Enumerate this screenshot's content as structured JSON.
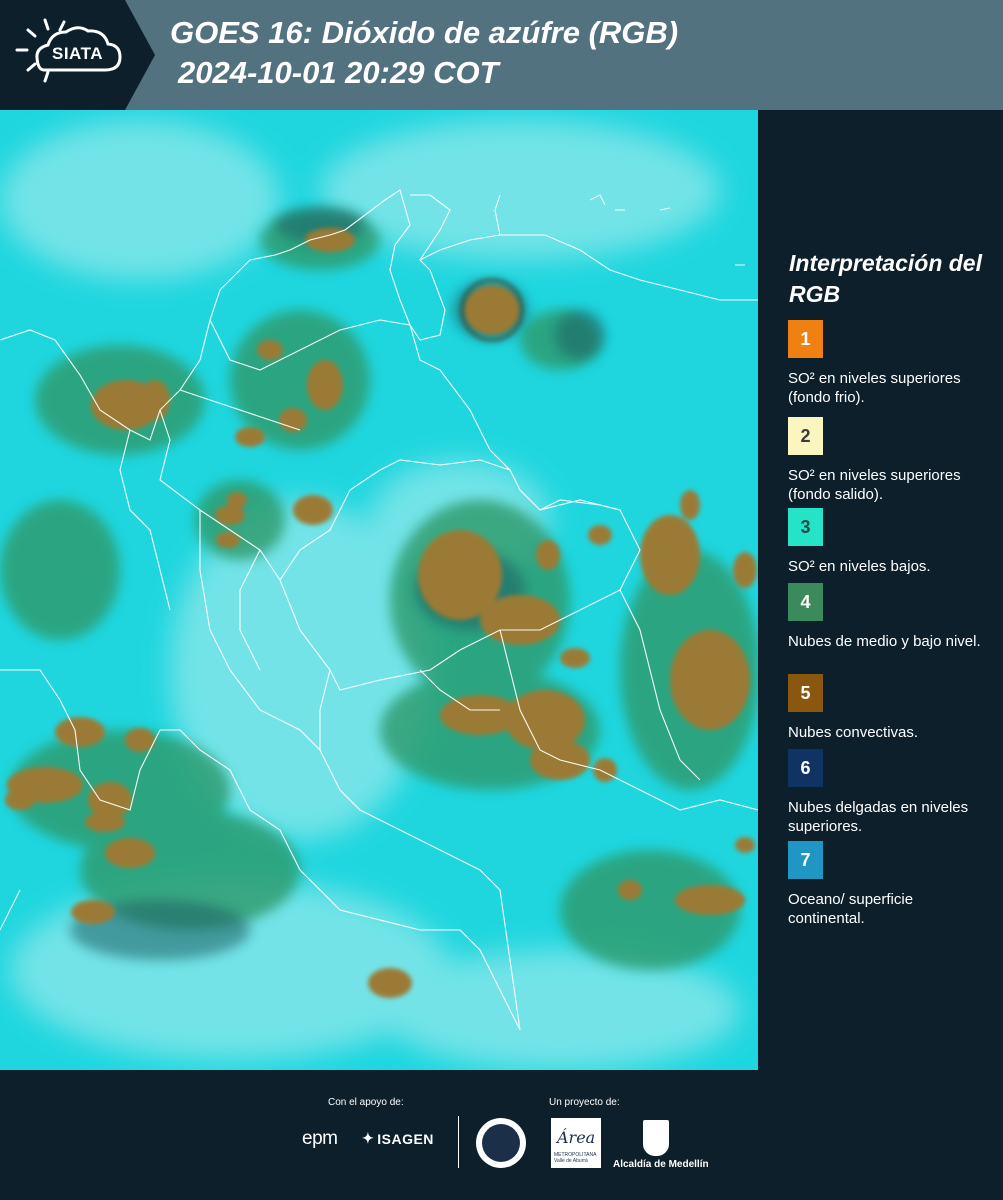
{
  "header": {
    "logo_text": "SIATA",
    "title": "GOES 16: Dióxido de azúfre (RGB)",
    "subtitle": "2024-10-01 20:29 COT",
    "background_color": "#52727f",
    "logo_color": "#0d1f2b"
  },
  "map": {
    "ocean_color": "#1fd6df",
    "cloud_color": "#9b7a36",
    "boundary_color": "#ffffff",
    "icons": [
      "country-boundaries",
      "convective-clouds"
    ]
  },
  "legend": {
    "title": "Interpretación del RGB",
    "items": [
      {
        "number": "1",
        "color": "#f08012",
        "text_color": "#ffffff",
        "label": "SO² en niveles superiores (fondo frio)."
      },
      {
        "number": "2",
        "color": "#fbf6bf",
        "text_color": "#3a3a3a",
        "label": "SO² en niveles superiores (fondo salido)."
      },
      {
        "number": "3",
        "color": "#24e3c6",
        "text_color": "#2a4a4a",
        "label": "SO² en niveles bajos."
      },
      {
        "number": "4",
        "color": "#3a8a5c",
        "text_color": "#ffffff",
        "label": "Nubes de medio y bajo nivel."
      },
      {
        "number": "5",
        "color": "#8a5710",
        "text_color": "#ffffff",
        "label": "Nubes convectivas."
      },
      {
        "number": "6",
        "color": "#0f3464",
        "text_color": "#ffffff",
        "label": "Nubes delgadas en niveles superiores."
      },
      {
        "number": "7",
        "color": "#2096c4",
        "text_color": "#ffffff",
        "label": "Oceano/ superficie continental."
      }
    ]
  },
  "footer": {
    "support_label": "Con el apoyo de:",
    "project_label": "Un proyecto de:",
    "epm": "epm",
    "isagen": "ISAGEN",
    "area_logo": "Área",
    "area_sub": "METROPOLITANA Valle de Aburrá",
    "alcaldia": "Alcaldía de Medellín"
  }
}
